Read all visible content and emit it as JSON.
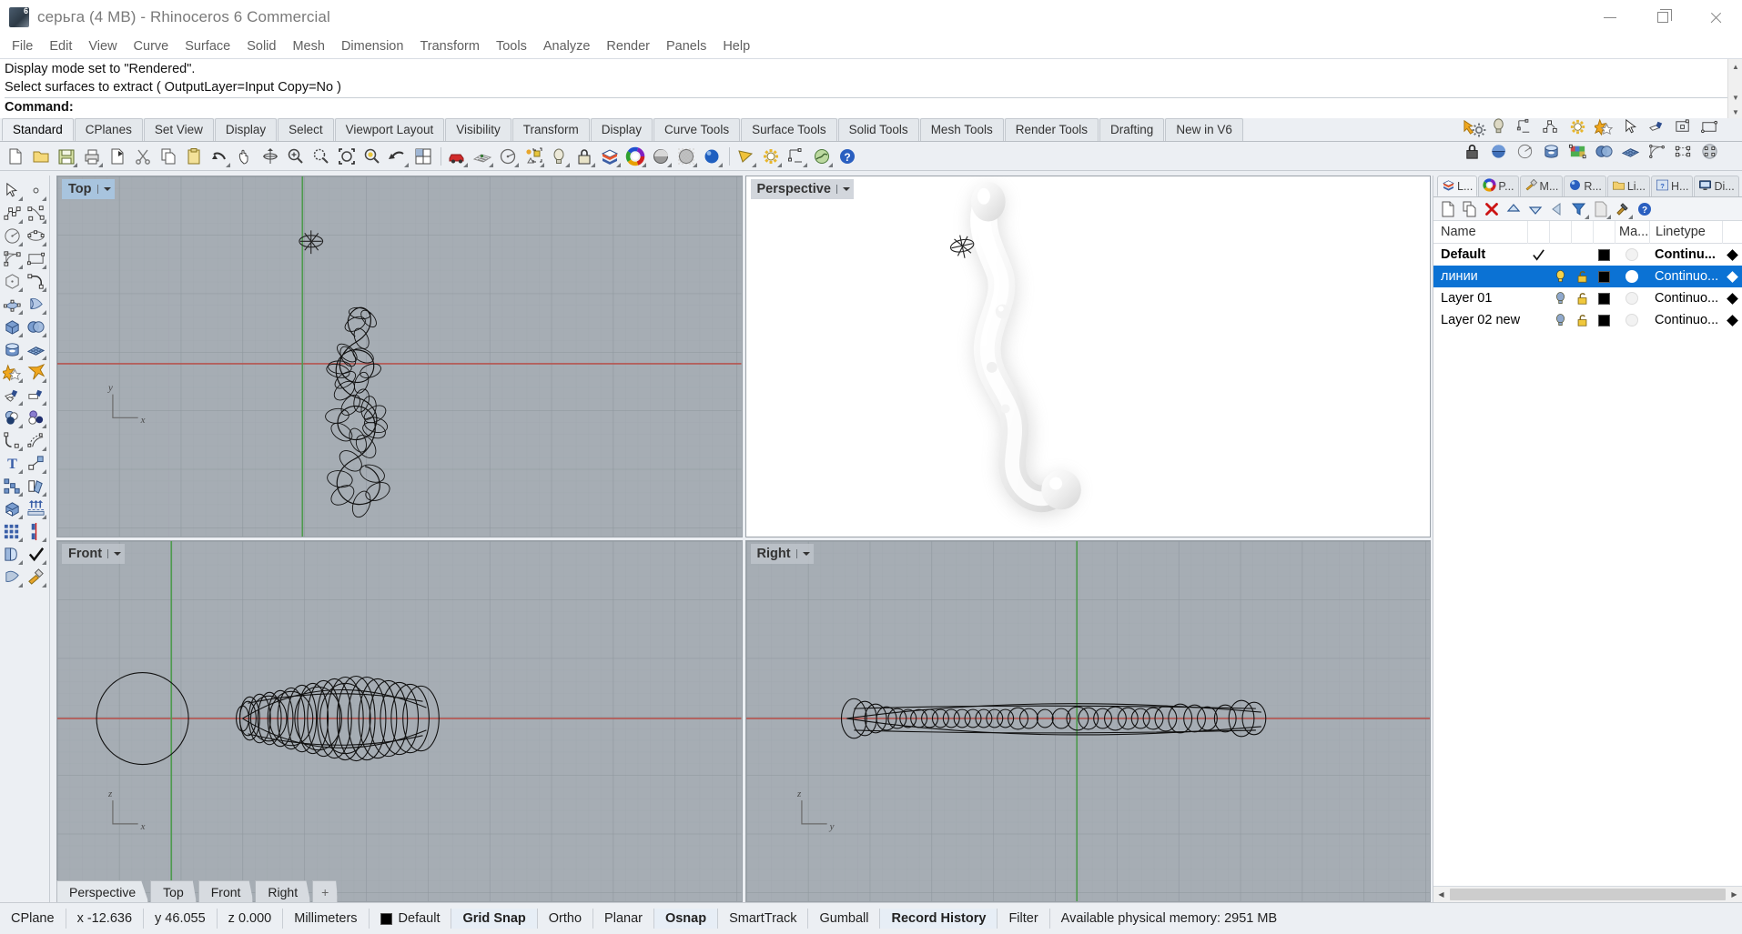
{
  "window": {
    "title": "серьга (4 MB) - Rhinoceros 6 Commercial",
    "app_icon": "rhino-logo-icon",
    "controls": {
      "minimize": "Minimize",
      "maximize": "Restore",
      "close": "Close"
    }
  },
  "menubar": {
    "items": [
      "File",
      "Edit",
      "View",
      "Curve",
      "Surface",
      "Solid",
      "Mesh",
      "Dimension",
      "Transform",
      "Tools",
      "Analyze",
      "Render",
      "Panels",
      "Help"
    ]
  },
  "command_area": {
    "history": [
      "Display mode set to \"Rendered\".",
      "Select surfaces to extract ( OutputLayer=Input  Copy=No )"
    ],
    "prompt_label": "Command:",
    "prompt_value": ""
  },
  "toolbar_tabs": {
    "items": [
      "Standard",
      "CPlanes",
      "Set View",
      "Display",
      "Select",
      "Viewport Layout",
      "Visibility",
      "Transform",
      "Display",
      "Curve Tools",
      "Surface Tools",
      "Solid Tools",
      "Mesh Tools",
      "Render Tools",
      "Drafting",
      "New in V6"
    ],
    "active": "Standard",
    "settings_icon": "gear-icon"
  },
  "main_toolbar": {
    "icons": [
      "new-file-icon",
      "open-folder-icon",
      "save-icon",
      "print-icon",
      "copy-to-clipboard-icon",
      "cut-scissors-icon",
      "copy-icon",
      "paste-icon",
      "undo-icon",
      "pan-hand-icon",
      "rotate-view-icon",
      "zoom-in-icon",
      "zoom-window-icon",
      "zoom-extents-icon",
      "zoom-selected-icon",
      "zoom-previous-icon",
      "four-viewports-icon",
      "car-render-icon",
      "grid-snap-icon",
      "circle-radius-icon",
      "select-objects-icon",
      "light-bulb-icon",
      "lock-icon",
      "layers-icon",
      "color-wheel-icon",
      "shaded-sphere-icon",
      "ghosted-sphere-icon",
      "rendered-sphere-icon",
      "render-preview-icon",
      "render-settings-gear-icon",
      "dimension-icon",
      "environment-icon",
      "help-icon"
    ]
  },
  "left_toolbar": {
    "icons": [
      "select-arrow-icon",
      "point-icon",
      "polyline-icon",
      "curve-icon",
      "circle-icon",
      "ellipse-icon",
      "arc-icon",
      "rectangle-icon",
      "polygon-icon",
      "curve-fillet-icon",
      "surface-from-points-icon",
      "surface-sweep-icon",
      "box-icon",
      "sphere-boolean-icon",
      "cylinder-icon",
      "mesh-plane-icon",
      "boolean-union-icon",
      "explode-icon",
      "split-icon",
      "trim-icon",
      "boolean-two-icon",
      "boolean-difference-icon",
      "fillet-curve-icon",
      "offset-curve-icon",
      "text-icon",
      "scale-icon",
      "array-icon",
      "copy-objects-icon",
      "cap-icon",
      "extrude-icon",
      "rectangular-array-icon",
      "mirror-icon",
      "unroll-icon",
      "check-object-icon",
      "surface-analysis-icon",
      "paint-icon"
    ]
  },
  "right_toolbar": {
    "row1": [
      "select-lasso-icon",
      "light-bulb-icon",
      "dimension-icon",
      "polyline-icon",
      "render-gear-icon",
      "boolean-union-icon",
      "select-arrow-icon",
      "split-icon",
      "surface-patch-icon",
      "rectangle-icon",
      "lock-icon"
    ],
    "row2": [
      "shaded-sphere-icon",
      "circle-radius-icon",
      "cylinder-icon",
      "texture-icon",
      "sphere-boolean-icon",
      "mesh-plane-icon",
      "arc-icon",
      "control-points-icon",
      "rebuild-icon"
    ]
  },
  "viewports": [
    {
      "name": "Top",
      "state": "active",
      "axes": [
        "y",
        "x"
      ],
      "bg": "#a6adb4"
    },
    {
      "name": "Perspective",
      "state": "normal",
      "axes": [],
      "bg": "#ffffff"
    },
    {
      "name": "Front",
      "state": "normal",
      "axes": [
        "z",
        "x"
      ],
      "bg": "#a6adb4"
    },
    {
      "name": "Right",
      "state": "normal",
      "axes": [
        "z",
        "y"
      ],
      "bg": "#a6adb4"
    }
  ],
  "viewport_tabs": {
    "items": [
      "Perspective",
      "Top",
      "Front",
      "Right"
    ],
    "active": "Perspective",
    "add_label": "+"
  },
  "panel": {
    "tabs": [
      {
        "label": "L...",
        "icon": "layers-icon",
        "active": true
      },
      {
        "label": "P...",
        "icon": "color-wheel-icon",
        "active": false
      },
      {
        "label": "M...",
        "icon": "material-brush-icon",
        "active": false
      },
      {
        "label": "R...",
        "icon": "render-sphere-icon",
        "active": false
      },
      {
        "label": "Li...",
        "icon": "folder-icon",
        "active": false
      },
      {
        "label": "H...",
        "icon": "help-window-icon",
        "active": false
      },
      {
        "label": "Di...",
        "icon": "display-monitor-icon",
        "active": false
      }
    ],
    "settings_icon": "gear-icon",
    "toolbar_icons": [
      "new-layer-icon",
      "copy-layer-icon",
      "delete-layer-icon",
      "move-up-icon",
      "move-down-icon",
      "back-arrow-icon",
      "filter-icon",
      "properties-page-icon",
      "tools-hammer-icon",
      "help-icon"
    ],
    "columns": {
      "name": "Name",
      "material": "Ma...",
      "linetype": "Linetype"
    },
    "layers": [
      {
        "name": "Default",
        "bold": true,
        "current": true,
        "selected": false,
        "visible": null,
        "locked": null,
        "color": "#000000",
        "material_on": false,
        "linetype": "Continu...",
        "print_color": "#000000"
      },
      {
        "name": "линии",
        "bold": false,
        "current": false,
        "selected": true,
        "visible": true,
        "locked": false,
        "color": "#000000",
        "material_on": true,
        "linetype": "Continuo...",
        "print_color": "#000000"
      },
      {
        "name": "Layer 01",
        "bold": false,
        "current": false,
        "selected": false,
        "visible": true,
        "locked": false,
        "color": "#000000",
        "material_on": false,
        "linetype": "Continuo...",
        "print_color": "#000000"
      },
      {
        "name": "Layer 02 new",
        "bold": false,
        "current": false,
        "selected": false,
        "visible": true,
        "locked": false,
        "color": "#000000",
        "material_on": false,
        "linetype": "Continuo...",
        "print_color": "#000000"
      }
    ]
  },
  "statusbar": {
    "cplane": "CPlane",
    "x": "x -12.636",
    "y": "y 46.055",
    "z": "z 0.000",
    "units": "Millimeters",
    "layer": "Default",
    "layer_color": "#000000",
    "toggles": [
      {
        "label": "Grid Snap",
        "on": true
      },
      {
        "label": "Ortho",
        "on": false
      },
      {
        "label": "Planar",
        "on": false
      },
      {
        "label": "Osnap",
        "on": true
      },
      {
        "label": "SmartTrack",
        "on": false
      },
      {
        "label": "Gumball",
        "on": false
      },
      {
        "label": "Record History",
        "on": true
      },
      {
        "label": "Filter",
        "on": false
      }
    ],
    "memory": "Available physical memory: 2951 MB"
  },
  "colors": {
    "selection_blue": "#0b72d4",
    "viewport_gray": "#a6adb4",
    "chrome": "#eceff3",
    "axis_red": "#c1504e",
    "axis_green": "#3f9a3f"
  }
}
